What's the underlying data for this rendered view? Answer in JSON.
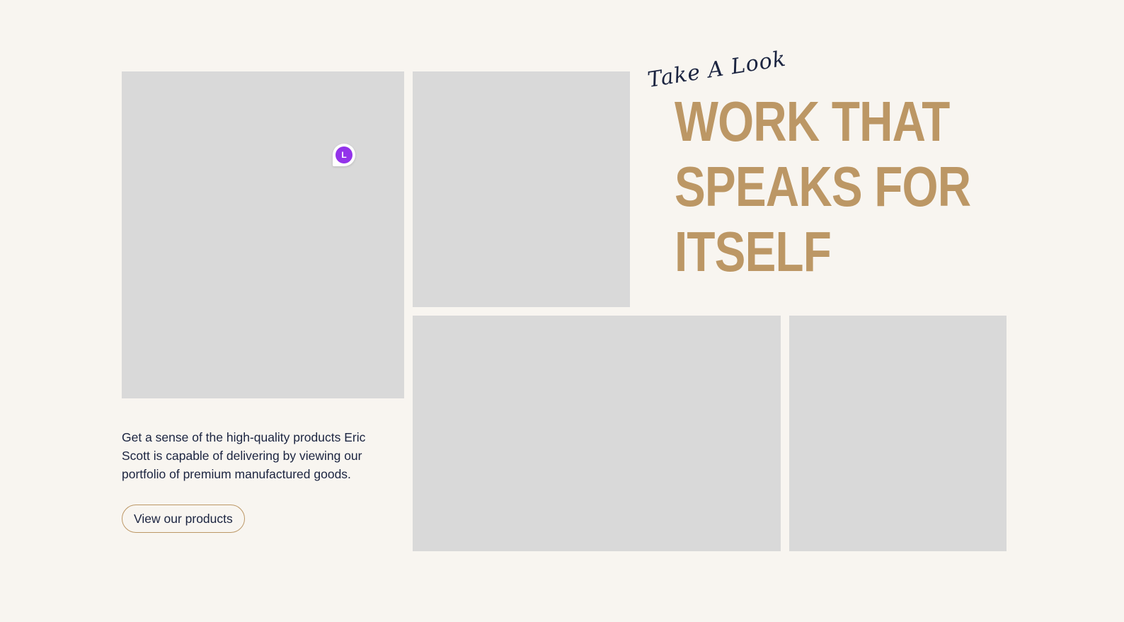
{
  "colors": {
    "background": "#f8f5f0",
    "placeholder": "#d9d9d9",
    "accent": "#bc9765",
    "text": "#1b2440",
    "avatar": "#9333ea"
  },
  "gallery": {
    "tiles": [
      "image-placeholder",
      "image-placeholder",
      "image-placeholder",
      "image-placeholder"
    ]
  },
  "avatar": {
    "initial": "L"
  },
  "hero": {
    "script_label": "Take A Look",
    "headline_lines": [
      "WORK THAT",
      "SPEAKS FOR",
      "ITSELF"
    ]
  },
  "intro": {
    "description": "Get a sense of the high-quality products Eric Scott is capable of delivering by viewing our portfolio of premium manufactured goods.",
    "button_label": "View our products"
  }
}
